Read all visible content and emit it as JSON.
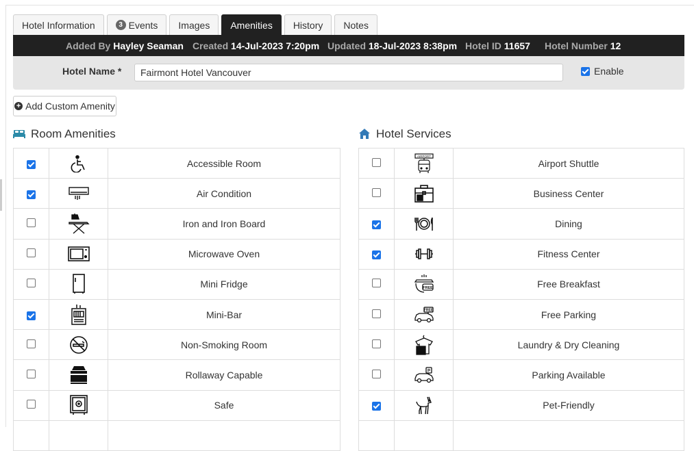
{
  "tabs": [
    {
      "label": "Hotel Information",
      "active": false
    },
    {
      "label": "Events",
      "badge": "3",
      "active": false
    },
    {
      "label": "Images",
      "active": false
    },
    {
      "label": "Amenities",
      "active": true
    },
    {
      "label": "History",
      "active": false
    },
    {
      "label": "Notes",
      "active": false
    }
  ],
  "info": {
    "added_by_label": "Added By",
    "added_by": "Hayley Seaman",
    "created_label": "Created",
    "created": "14-Jul-2023 7:20pm",
    "updated_label": "Updated",
    "updated": "18-Jul-2023 8:38pm",
    "hotel_id_label": "Hotel ID",
    "hotel_id": "11657",
    "hotel_number_label": "Hotel Number",
    "hotel_number": "12"
  },
  "hotel_name": {
    "label": "Hotel Name *",
    "value": "Fairmont Hotel Vancouver",
    "enable_label": "Enable",
    "enabled": true
  },
  "add_button": {
    "label": "Add Custom Amenity",
    "icon": "plus-circle-icon"
  },
  "room_amenities": {
    "title": "Room Amenities",
    "icon": "bed-icon",
    "items": [
      {
        "label": "Accessible Room",
        "checked": true,
        "icon": "wheelchair-icon"
      },
      {
        "label": "Air Condition",
        "checked": true,
        "icon": "air-conditioner-icon"
      },
      {
        "label": "Iron and Iron Board",
        "checked": false,
        "icon": "iron-board-icon"
      },
      {
        "label": "Microwave Oven",
        "checked": false,
        "icon": "microwave-icon"
      },
      {
        "label": "Mini Fridge",
        "checked": false,
        "icon": "fridge-icon"
      },
      {
        "label": "Mini-Bar",
        "checked": true,
        "icon": "minibar-icon"
      },
      {
        "label": "Non-Smoking Room",
        "checked": false,
        "icon": "no-smoking-icon"
      },
      {
        "label": "Rollaway Capable",
        "checked": false,
        "icon": "rollaway-bed-icon"
      },
      {
        "label": "Safe",
        "checked": false,
        "icon": "safe-icon"
      }
    ]
  },
  "hotel_services": {
    "title": "Hotel Services",
    "icon": "home-icon",
    "items": [
      {
        "label": "Airport Shuttle",
        "checked": false,
        "icon": "airport-shuttle-icon",
        "icon_text": "AIRPORT"
      },
      {
        "label": "Business Center",
        "checked": false,
        "icon": "briefcase-icon"
      },
      {
        "label": "Dining",
        "checked": true,
        "icon": "dining-icon"
      },
      {
        "label": "Fitness Center",
        "checked": true,
        "icon": "dumbbell-icon"
      },
      {
        "label": "Free Breakfast",
        "checked": false,
        "icon": "free-breakfast-icon",
        "icon_text": "FREE"
      },
      {
        "label": "Free Parking",
        "checked": false,
        "icon": "free-parking-icon",
        "icon_text": "FREE"
      },
      {
        "label": "Laundry & Dry Cleaning",
        "checked": false,
        "icon": "laundry-icon"
      },
      {
        "label": "Parking Available",
        "checked": false,
        "icon": "parking-icon",
        "icon_text": "P"
      },
      {
        "label": "Pet-Friendly",
        "checked": true,
        "icon": "pet-icon"
      }
    ]
  },
  "colors": {
    "dark_bar": "#212121",
    "checkbox_accent": "#1a73e8",
    "home_icon": "#337ab7",
    "bed_icon": "#2b8aa8"
  }
}
